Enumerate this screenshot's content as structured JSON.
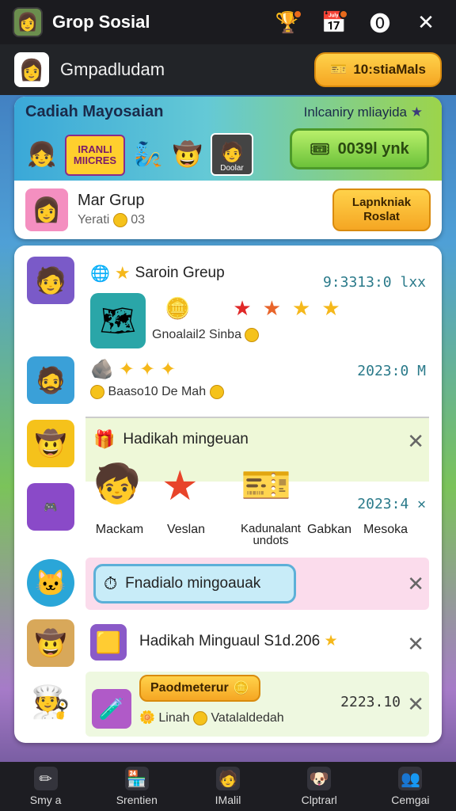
{
  "topbar": {
    "title": "Grop Sosial",
    "app_icon": "group-avatar-icon",
    "buttons": [
      "trophy-icon",
      "calendar-icon",
      "alert-icon",
      "close-icon"
    ]
  },
  "header": {
    "name": "Gmpadludam",
    "coin_button": "10:stiaMals"
  },
  "hero": {
    "title": "Cadiah Mayosaian",
    "subtitle": "Inlcaniry mliayida",
    "logo_text": "IRANLI MIICRES",
    "photo_caption": "Doolar",
    "cta": "0039l ynk",
    "group_name": "Mar Grup",
    "group_sub": "Yerati",
    "group_count": "03",
    "group_button": "Lapnkniak Roslat"
  },
  "feed": {
    "item1": {
      "title": "Saroin Greup",
      "time": "9:3313:0 lxx",
      "reward_caption": "Gnoalail2 Sinba"
    },
    "item2": {
      "text": "Baaso10 De Mah",
      "time": "2023:0 M"
    },
    "weekly": {
      "title": "Hadikah mingeuan",
      "time": "2023:4",
      "rewards": [
        {
          "label": "Mackam"
        },
        {
          "label": "Veslan"
        },
        {
          "label": "Kadunalant undots"
        },
        {
          "label": "Gabkan"
        },
        {
          "label": "Mesoka"
        }
      ]
    },
    "item3": {
      "pill": "Fnadialo mingoauak"
    },
    "item4": {
      "text": "Hadikah Minguaul S1d.206"
    },
    "item5": {
      "badge": "Paodmeterur",
      "sub1": "Linah",
      "sub2": "Vatalaldedah",
      "time": "2223.10"
    }
  },
  "nav": [
    {
      "label": "Smy a",
      "icon": "edit-icon"
    },
    {
      "label": "Srentien",
      "icon": "shop-icon"
    },
    {
      "label": "IMalil",
      "icon": "profile-icon"
    },
    {
      "label": "Clptrarl",
      "icon": "pet-icon"
    },
    {
      "label": "Cemgai",
      "icon": "team-icon"
    }
  ]
}
